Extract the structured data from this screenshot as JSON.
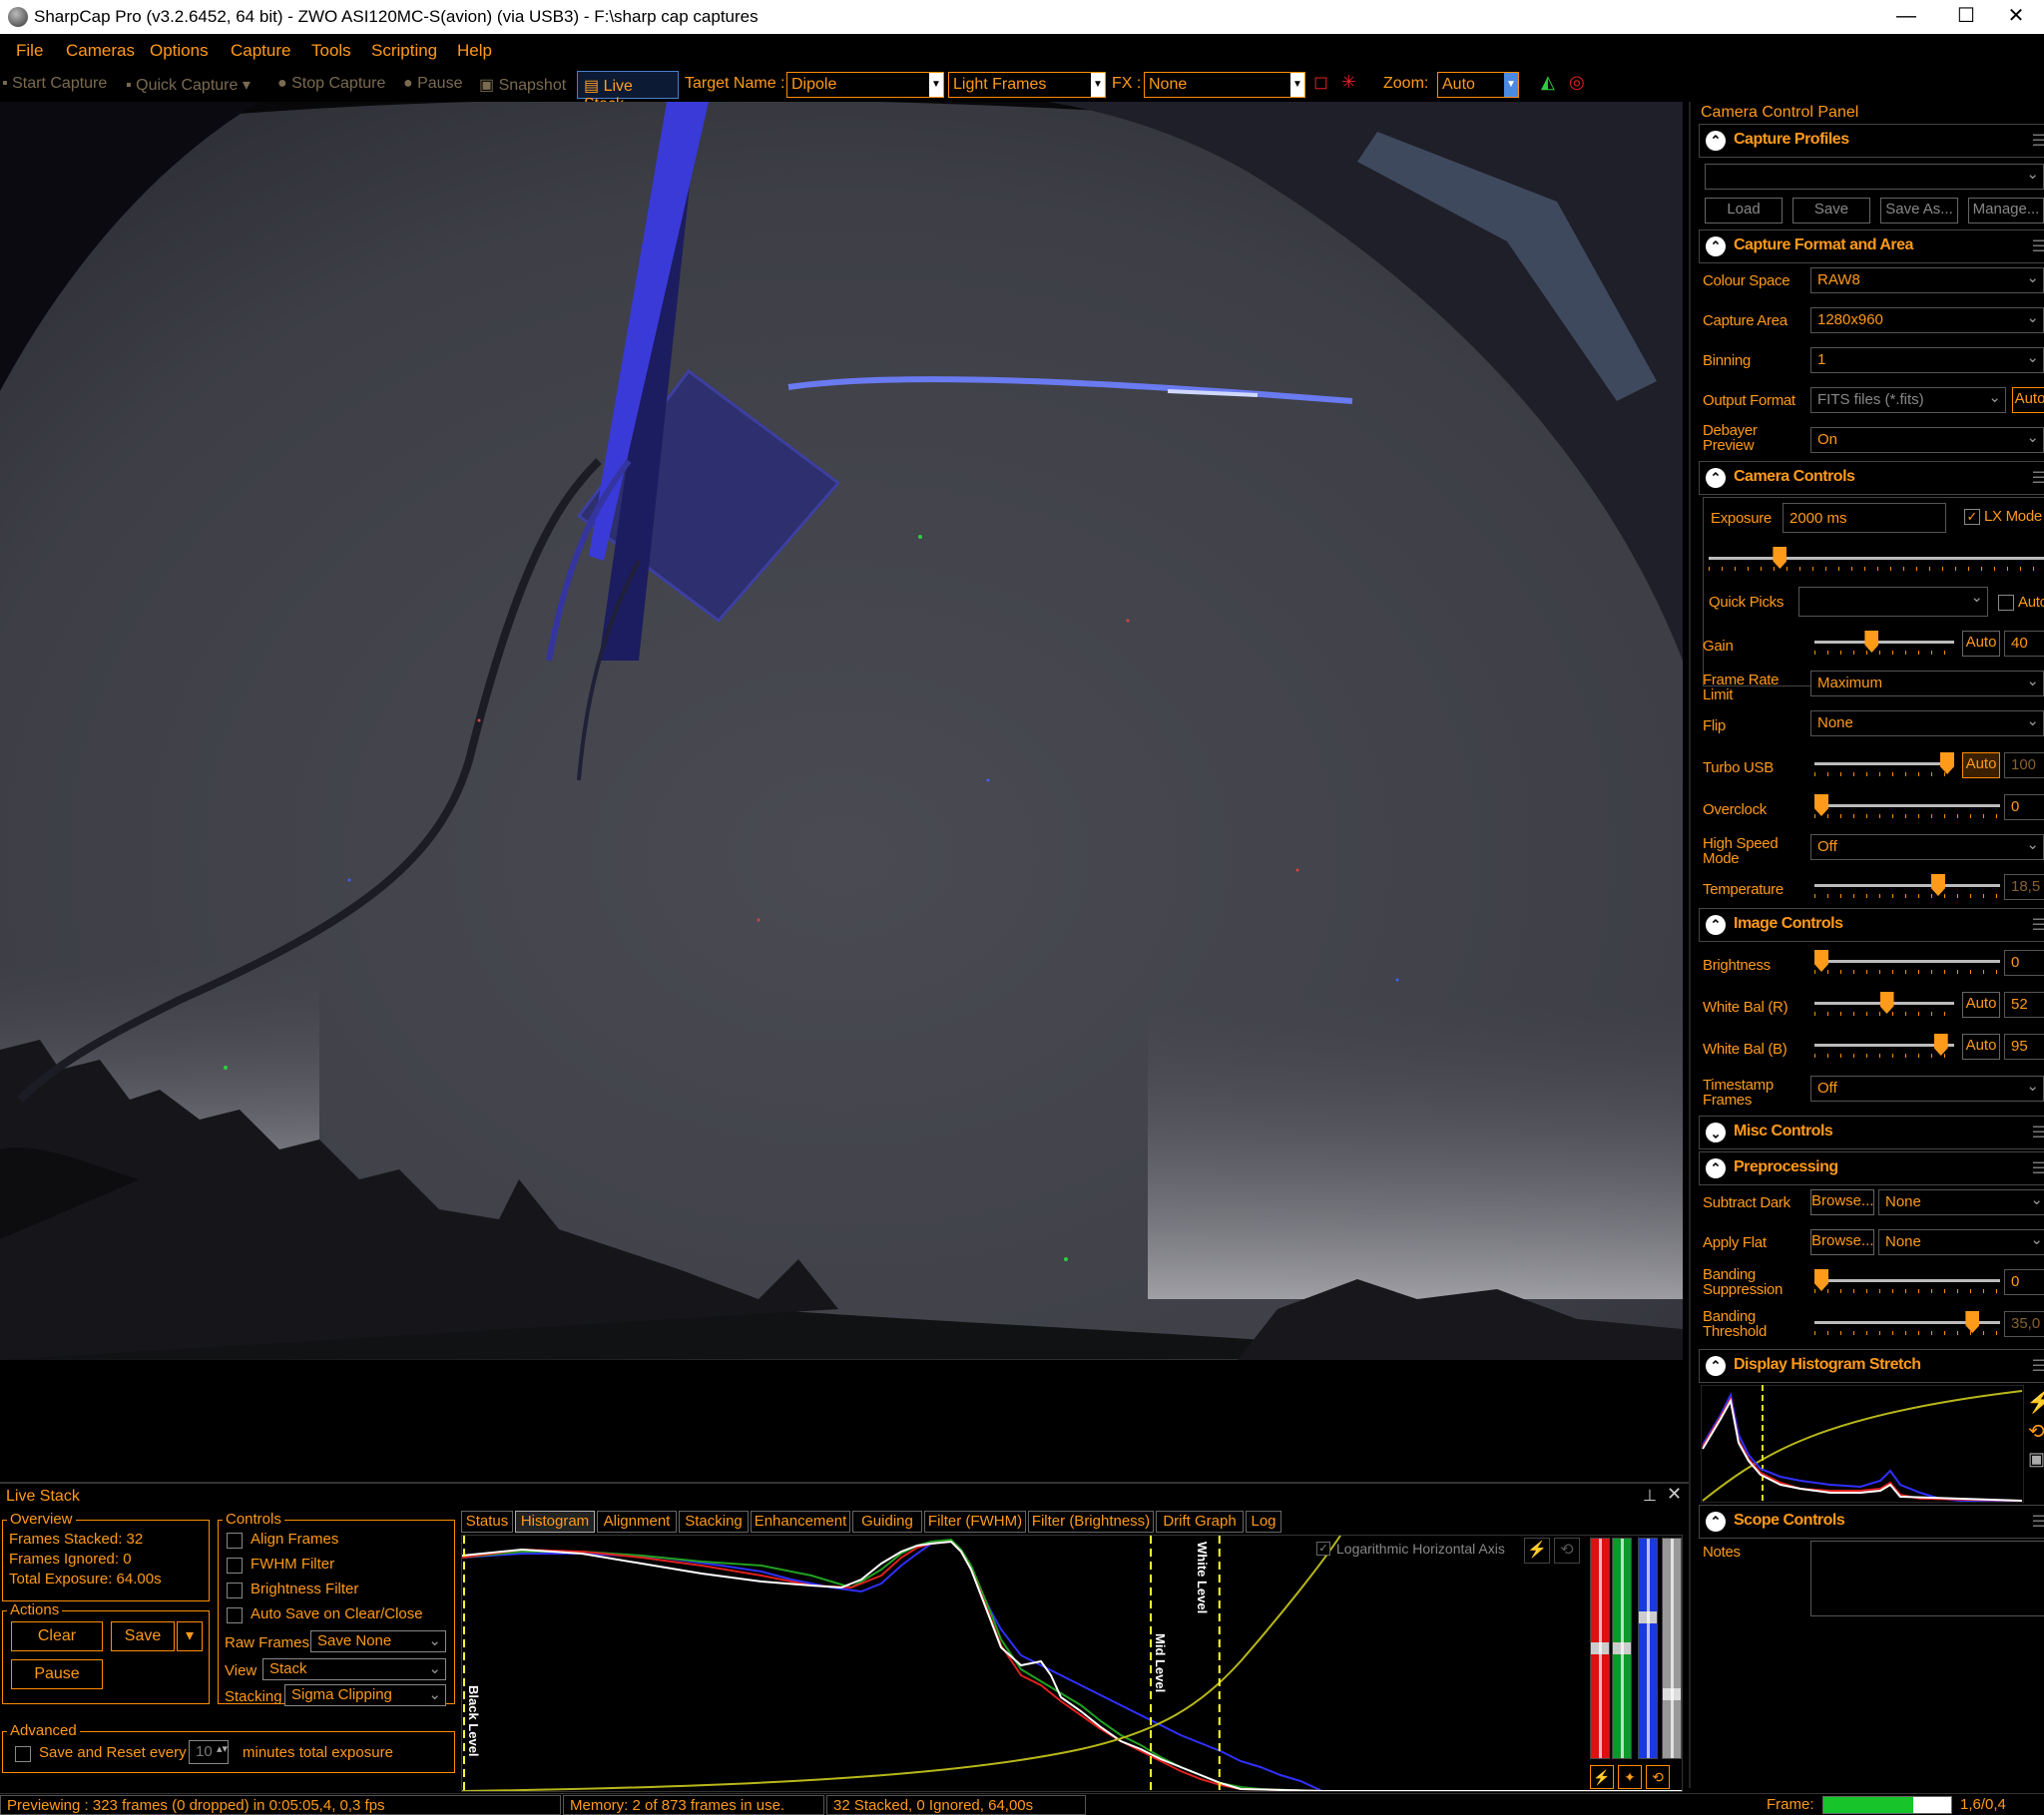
{
  "window": {
    "title": "SharpCap Pro (v3.2.6452, 64 bit) - ZWO ASI120MC-S(avion) (via USB3) - F:\\sharp cap captures",
    "minimize": "—",
    "maximize": "☐",
    "close": "✕"
  },
  "menu": [
    "File",
    "Cameras",
    "Options",
    "Capture",
    "Tools",
    "Scripting",
    "Help"
  ],
  "toolbar": {
    "start_capture": "Start Capture",
    "quick_capture": "Quick Capture",
    "stop_capture": "Stop Capture",
    "pause": "Pause",
    "snapshot": "Snapshot",
    "live_stack": "Live Stack",
    "target_name_label": "Target Name :",
    "target_name_value": "Dipole",
    "frame_type": "Light Frames",
    "fx_label": "FX :",
    "fx_value": "None",
    "zoom_label": "Zoom:",
    "zoom_value": "Auto"
  },
  "panel": {
    "title": "Camera Control Panel",
    "capture_profiles": {
      "title": "Capture Profiles",
      "profile_value": "",
      "load": "Load",
      "save": "Save",
      "save_as": "Save As...",
      "manage": "Manage..."
    },
    "capture_format": {
      "title": "Capture Format and Area",
      "colour_space_label": "Colour Space",
      "colour_space": "RAW8",
      "capture_area_label": "Capture Area",
      "capture_area": "1280x960",
      "binning_label": "Binning",
      "binning": "1",
      "output_format_label": "Output Format",
      "output_format": "FITS files (*.fits)",
      "output_auto": "Auto",
      "debayer_label_1": "Debayer",
      "debayer_label_2": "Preview",
      "debayer": "On"
    },
    "camera_controls": {
      "title": "Camera Controls",
      "exposure_label": "Exposure",
      "exposure": "2000 ms",
      "lx_mode": "LX Mode",
      "exposure_level": 0.2,
      "quick_picks_label": "Quick Picks",
      "quick_picks": "",
      "quick_picks_auto": "Auto",
      "gain_label": "Gain",
      "gain_auto": "Auto",
      "gain": "40",
      "gain_level": 0.4,
      "frame_rate_label_1": "Frame Rate",
      "frame_rate_label_2": "Limit",
      "frame_rate": "Maximum",
      "flip_label": "Flip",
      "flip": "None",
      "turbo_label": "Turbo USB",
      "turbo_auto": "Auto",
      "turbo": "100",
      "turbo_level": 1.0,
      "overclock_label": "Overclock",
      "overclock": "0",
      "overclock_level": 0.0,
      "high_speed_label_1": "High Speed",
      "high_speed_label_2": "Mode",
      "high_speed": "Off",
      "temperature_label": "Temperature",
      "temperature": "18,5",
      "temperature_level": 0.68
    },
    "image_controls": {
      "title": "Image Controls",
      "brightness_label": "Brightness",
      "brightness": "0",
      "brightness_level": 0.0,
      "wb_r_label": "White Bal (R)",
      "wb_r_auto": "Auto",
      "wb_r": "52",
      "wb_r_level": 0.52,
      "wb_b_label": "White Bal (B)",
      "wb_b_auto": "Auto",
      "wb_b": "95",
      "wb_b_level": 0.95,
      "timestamp_label_1": "Timestamp",
      "timestamp_label_2": "Frames",
      "timestamp": "Off"
    },
    "misc_controls": {
      "title": "Misc Controls"
    },
    "preprocessing": {
      "title": "Preprocessing",
      "subtract_dark_label": "Subtract Dark",
      "browse": "Browse...",
      "subtract_dark": "None",
      "apply_flat_label": "Apply Flat",
      "apply_flat": "None",
      "banding_sup_label_1": "Banding",
      "banding_sup_label_2": "Suppression",
      "banding_sup": "0",
      "banding_sup_level": 0.0,
      "banding_thr_label_1": "Banding",
      "banding_thr_label_2": "Threshold",
      "banding_thr": "35,0",
      "banding_thr_level": 0.88
    },
    "display_histogram": {
      "title": "Display Histogram Stretch"
    },
    "scope_controls": {
      "title": "Scope Controls",
      "notes_label": "Notes",
      "notes": ""
    }
  },
  "livestack": {
    "title": "Live Stack",
    "overview": {
      "title": "Overview",
      "frames_stacked": "Frames Stacked: 32",
      "frames_ignored": "Frames Ignored:  0",
      "total_exposure": "Total Exposure:  64.00s"
    },
    "actions": {
      "title": "Actions",
      "clear": "Clear",
      "save": "Save",
      "pause": "Pause"
    },
    "controls": {
      "title": "Controls",
      "align_frames": "Align Frames",
      "fwhm_filter": "FWHM Filter",
      "brightness_filter": "Brightness Filter",
      "auto_save": "Auto Save on Clear/Close",
      "raw_frames_label": "Raw Frames",
      "raw_frames": "Save None",
      "view_label": "View",
      "view": "Stack",
      "stacking_label": "Stacking",
      "stacking": "Sigma Clipping"
    },
    "advanced": {
      "title": "Advanced",
      "save_reset_label": "Save and Reset every",
      "save_reset_value": "10",
      "save_reset_suffix": "minutes total exposure"
    },
    "tabs": [
      "Status",
      "Histogram",
      "Alignment",
      "Stacking",
      "Enhancement",
      "Guiding",
      "Filter (FWHM)",
      "Filter (Brightness)",
      "Drift Graph",
      "Log"
    ],
    "histogram": {
      "log_axis_label": "Logarithmic Horizontal Axis",
      "black_level": "Black Level",
      "mid_level": "Mid Level",
      "white_level": "White Level",
      "black_level_pos": 0.0,
      "mid_level_pos": 0.8,
      "white_level_pos": 0.88,
      "red_level": 0.5,
      "green_level": 0.5,
      "blue_level": 0.35,
      "grey_level": 0.72
    }
  },
  "status": {
    "previewing": "Previewing : 323 frames (0 dropped) in 0:05:05,4, 0,3 fps",
    "memory": "Memory: 2 of 873 frames in use.",
    "stacked": "32 Stacked, 0 Ignored, 64,00s",
    "frame_label": "Frame:",
    "frame_value": "1,6/0,4",
    "frame_progress": 0.7
  },
  "colors": {
    "accent": "#ff9a1a",
    "border": "#ff8c00",
    "live_stack_btn": "#4a7fd0"
  }
}
